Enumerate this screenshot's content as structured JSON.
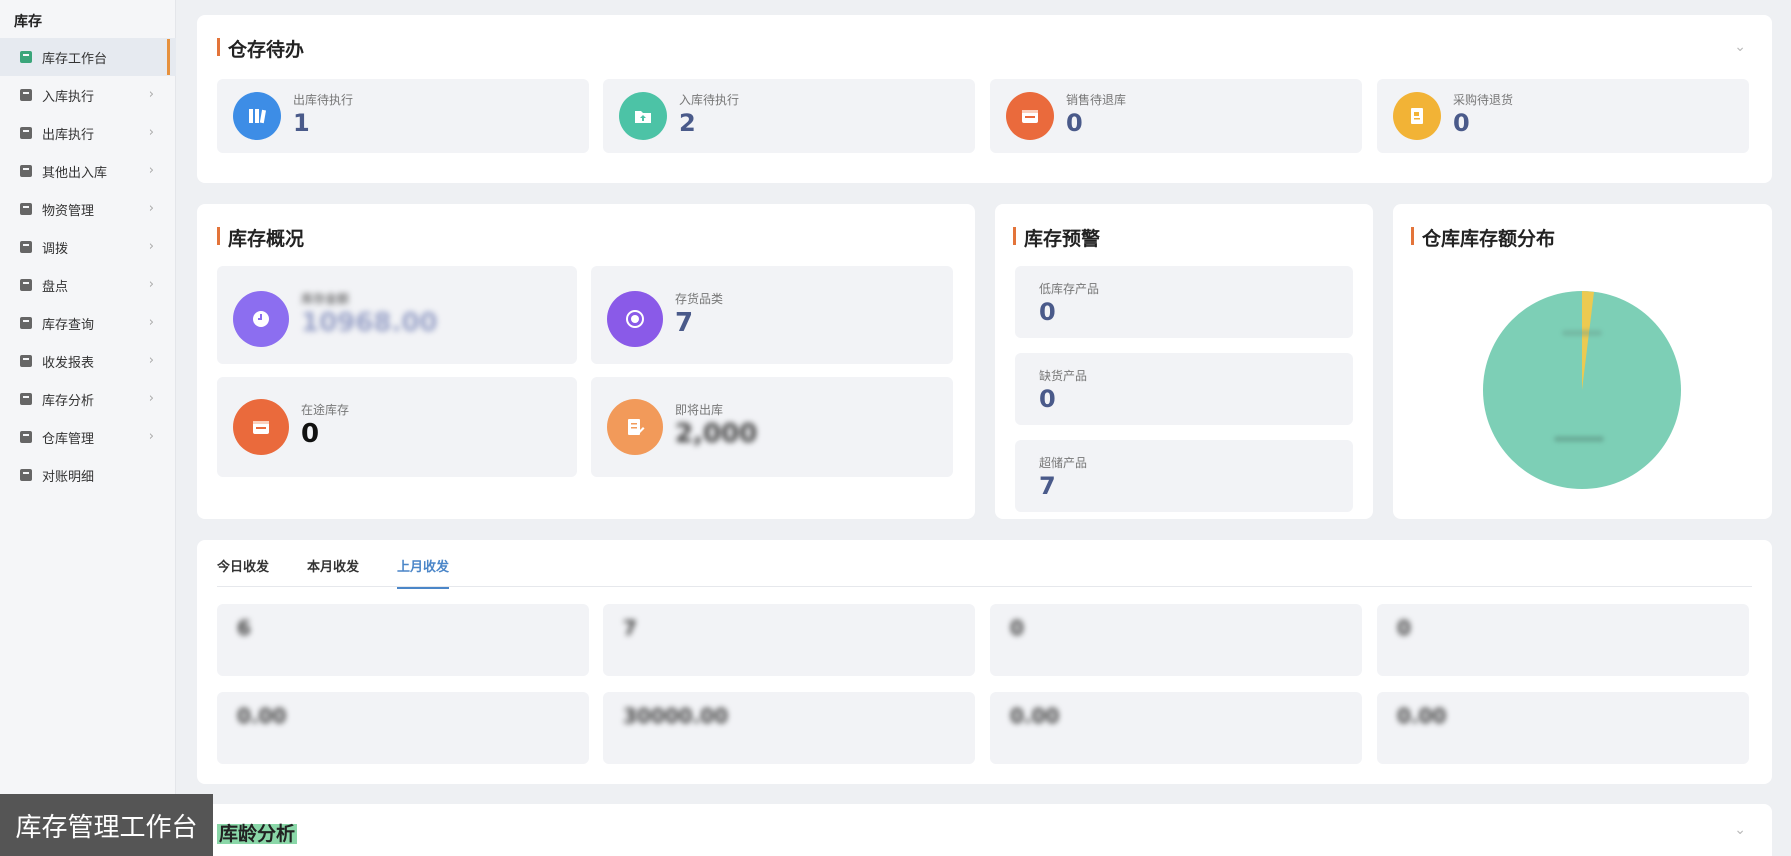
{
  "sidebar": {
    "header": "库存",
    "items": [
      {
        "label": "库存工作台",
        "icon": "workbench-icon",
        "active": true,
        "chevron": ""
      },
      {
        "label": "入库执行",
        "icon": "document-icon",
        "chevron": "›"
      },
      {
        "label": "出库执行",
        "icon": "document-icon",
        "chevron": "›"
      },
      {
        "label": "其他出入库",
        "icon": "document-icon",
        "chevron": "›"
      },
      {
        "label": "物资管理",
        "icon": "box-icon",
        "chevron": "›"
      },
      {
        "label": "调拨",
        "icon": "transfer-icon",
        "chevron": "›"
      },
      {
        "label": "盘点",
        "icon": "checklist-icon",
        "chevron": "›"
      },
      {
        "label": "库存查询",
        "icon": "search-doc-icon",
        "chevron": "›"
      },
      {
        "label": "收发报表",
        "icon": "report-icon",
        "chevron": "›"
      },
      {
        "label": "库存分析",
        "icon": "chart-icon",
        "chevron": "›"
      },
      {
        "label": "仓库管理",
        "icon": "warehouse-icon",
        "chevron": "›"
      },
      {
        "label": "对账明细",
        "icon": "ledger-icon",
        "chevron": ""
      }
    ]
  },
  "todo": {
    "title": "仓存待办",
    "collapse": "⌄",
    "tiles": [
      {
        "label": "出库待执行",
        "value": "1",
        "icon": "books-icon",
        "color": "#3d8de6"
      },
      {
        "label": "入库待执行",
        "value": "2",
        "icon": "folder-upload-icon",
        "color": "#4cc3a6"
      },
      {
        "label": "销售待退库",
        "value": "0",
        "icon": "calendar-icon",
        "color": "#ea6a3c"
      },
      {
        "label": "采购待退货",
        "value": "0",
        "icon": "notebook-icon",
        "color": "#f2b336"
      }
    ]
  },
  "overview": {
    "title": "库存概况",
    "tiles": [
      {
        "label": "库存金额",
        "value": "10968.00",
        "icon": "clock-icon",
        "color": "#8c6ef0",
        "blurred": true
      },
      {
        "label": "存货品类",
        "value": "7",
        "icon": "target-icon",
        "color": "#8a5ae8"
      },
      {
        "label": "在途库存",
        "value": "0",
        "icon": "calendar-icon",
        "color": "#ea6a3c"
      },
      {
        "label": "即将出库",
        "value": "2,000",
        "icon": "edit-doc-icon",
        "color": "#f29a5a",
        "blurred": true
      }
    ]
  },
  "alert": {
    "title": "库存预警",
    "tiles": [
      {
        "label": "低库存产品",
        "value": "0"
      },
      {
        "label": "缺货产品",
        "value": "0"
      },
      {
        "label": "超储产品",
        "value": "7"
      }
    ]
  },
  "distribution": {
    "title": "仓库库存额分布",
    "colors": {
      "main": "#7dcfb6",
      "minor": "#f2c94c"
    }
  },
  "flow": {
    "tabs": [
      "今日收发",
      "本月收发",
      "上月收发"
    ],
    "active_tab": 2,
    "row1": [
      "6",
      "7",
      "0",
      "0"
    ],
    "row2": [
      "0.00",
      "30000.00",
      "0.00",
      "0.00"
    ]
  },
  "age": {
    "title": "库龄分析",
    "collapse": "⌄"
  },
  "caption": "库存管理工作台"
}
